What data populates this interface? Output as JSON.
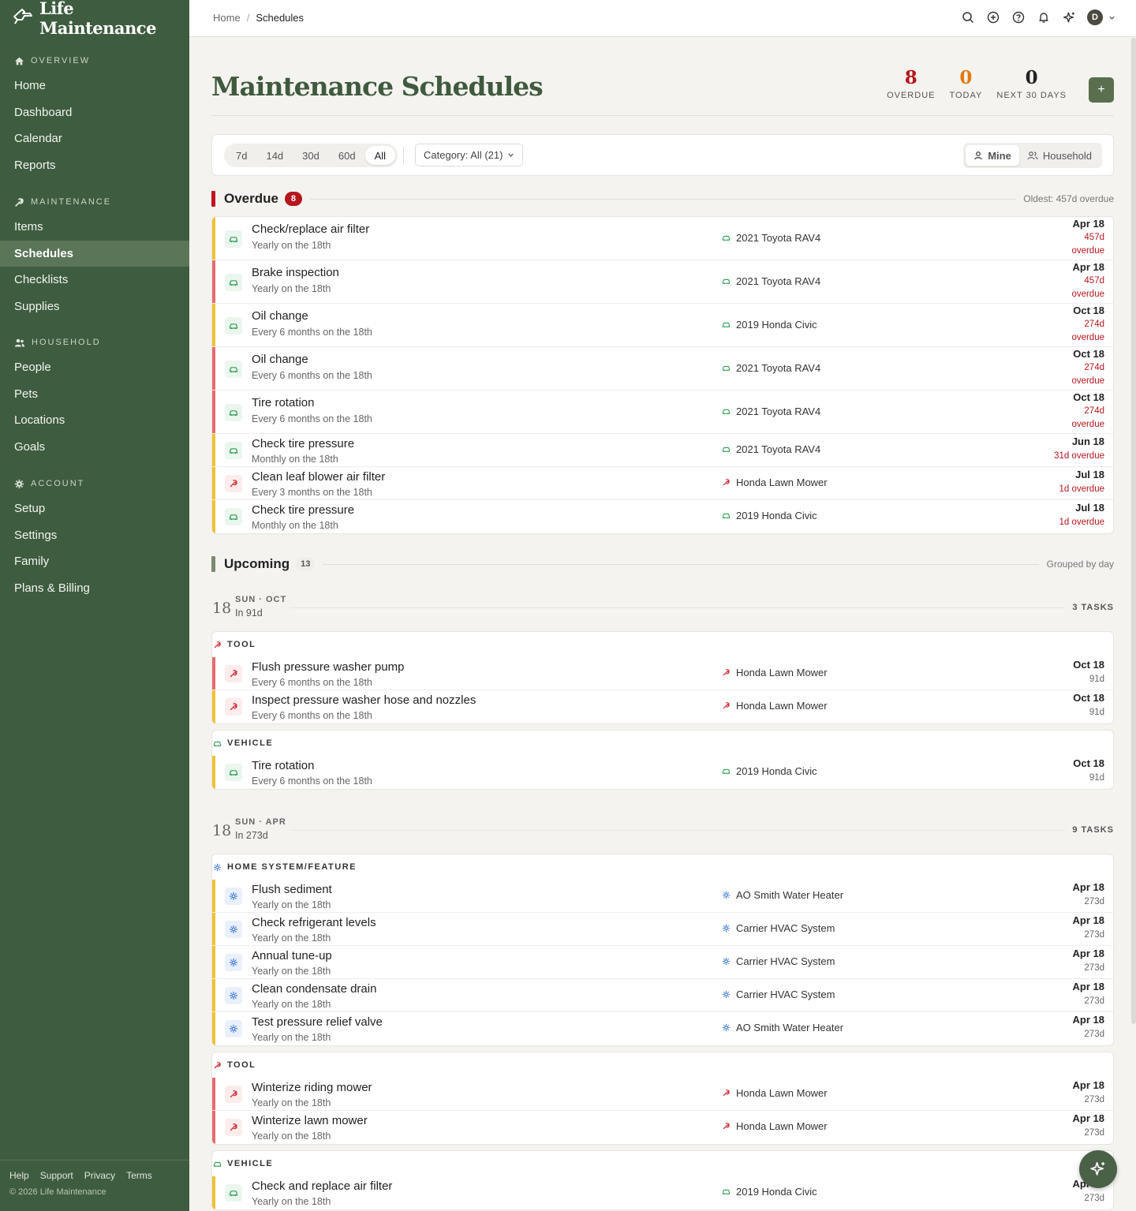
{
  "app": {
    "name": "Life Maintenance"
  },
  "sidebar": {
    "sections": [
      {
        "label": "OVERVIEW",
        "icon": "home-icon",
        "items": [
          "Home",
          "Dashboard",
          "Calendar",
          "Reports"
        ]
      },
      {
        "label": "MAINTENANCE",
        "icon": "wrench-icon",
        "items": [
          "Items",
          "Schedules",
          "Checklists",
          "Supplies"
        ]
      },
      {
        "label": "HOUSEHOLD",
        "icon": "people-icon",
        "items": [
          "People",
          "Pets",
          "Locations",
          "Goals"
        ]
      },
      {
        "label": "ACCOUNT",
        "icon": "gear-icon",
        "items": [
          "Setup",
          "Settings",
          "Family",
          "Plans & Billing"
        ]
      }
    ],
    "active": "Schedules",
    "footer_links": [
      "Help",
      "Support",
      "Privacy",
      "Terms"
    ],
    "copyright": "© 2026 Life Maintenance"
  },
  "breadcrumb": {
    "home": "Home",
    "sep": "/",
    "current": "Schedules"
  },
  "topbar": {
    "avatar_initial": "D",
    "icons": [
      "search-icon",
      "add-circle-icon",
      "help-icon",
      "bell-icon",
      "sparkle-icon"
    ]
  },
  "page": {
    "title": "Maintenance Schedules"
  },
  "stats": {
    "overdue": {
      "value": "8",
      "label": "OVERDUE",
      "color": "#b5161d"
    },
    "today": {
      "value": "0",
      "label": "TODAY",
      "color": "#e07b12"
    },
    "next30": {
      "value": "0",
      "label": "NEXT 30 DAYS",
      "color": "#222222"
    },
    "add_label": "+"
  },
  "filters": {
    "ranges": [
      "7d",
      "14d",
      "30d",
      "60d",
      "All"
    ],
    "active_range": "All",
    "category": "Category: All (21)",
    "scope": {
      "mine": "Mine",
      "household": "Household",
      "active": "Mine"
    }
  },
  "colors": {
    "vehicle": "#2f9d55",
    "tool": "#cf2e37",
    "home": "#2d6cd6",
    "bar_yellow": "#f0c232",
    "bar_red": "#e86a6f",
    "accent": "#3f5a3e"
  },
  "overdue": {
    "title": "Overdue",
    "count": "8",
    "oldest": "Oldest: 457d overdue",
    "rows": [
      {
        "title": "Check/replace air filter",
        "sub": "Yearly on the 18th",
        "item": "2021 Toyota RAV4",
        "cat": "vehicle",
        "bar": "yellow",
        "date": "Apr 18",
        "rel1": "457d",
        "rel2": "overdue"
      },
      {
        "title": "Brake inspection",
        "sub": "Yearly on the 18th",
        "item": "2021 Toyota RAV4",
        "cat": "vehicle",
        "bar": "red",
        "date": "Apr 18",
        "rel1": "457d",
        "rel2": "overdue"
      },
      {
        "title": "Oil change",
        "sub": "Every 6 months on the 18th",
        "item": "2019 Honda Civic",
        "cat": "vehicle",
        "bar": "yellow",
        "date": "Oct 18",
        "rel1": "274d",
        "rel2": "overdue"
      },
      {
        "title": "Oil change",
        "sub": "Every 6 months on the 18th",
        "item": "2021 Toyota RAV4",
        "cat": "vehicle",
        "bar": "red",
        "date": "Oct 18",
        "rel1": "274d",
        "rel2": "overdue"
      },
      {
        "title": "Tire rotation",
        "sub": "Every 6 months on the 18th",
        "item": "2021 Toyota RAV4",
        "cat": "vehicle",
        "bar": "red",
        "date": "Oct 18",
        "rel1": "274d",
        "rel2": "overdue"
      },
      {
        "title": "Check tire pressure",
        "sub": "Monthly on the 18th",
        "item": "2021 Toyota RAV4",
        "cat": "vehicle",
        "bar": "yellow",
        "date": "Jun 18",
        "rel1": "31d overdue"
      },
      {
        "title": "Clean leaf blower air filter",
        "sub": "Every 3 months on the 18th",
        "item": "Honda Lawn Mower",
        "cat": "tool",
        "bar": "yellow",
        "date": "Jul 18",
        "rel1": "1d overdue"
      },
      {
        "title": "Check tire pressure",
        "sub": "Monthly on the 18th",
        "item": "2019 Honda Civic",
        "cat": "vehicle",
        "bar": "yellow",
        "date": "Jul 18",
        "rel1": "1d overdue"
      }
    ]
  },
  "upcoming": {
    "title": "Upcoming",
    "count": "13",
    "note": "Grouped by day",
    "days": [
      {
        "num": "18",
        "label": "SUN · OCT",
        "sub": "In 91d",
        "count": "3 TASKS",
        "groups": [
          {
            "name": "TOOL",
            "cat": "tool",
            "rows": [
              {
                "title": "Flush pressure washer pump",
                "sub": "Every 6 months on the 18th",
                "item": "Honda Lawn Mower",
                "cat": "tool",
                "bar": "red",
                "date": "Oct 18",
                "rel1": "91d"
              },
              {
                "title": "Inspect pressure washer hose and nozzles",
                "sub": "Every 6 months on the 18th",
                "item": "Honda Lawn Mower",
                "cat": "tool",
                "bar": "yellow",
                "date": "Oct 18",
                "rel1": "91d"
              }
            ]
          },
          {
            "name": "VEHICLE",
            "cat": "vehicle",
            "rows": [
              {
                "title": "Tire rotation",
                "sub": "Every 6 months on the 18th",
                "item": "2019 Honda Civic",
                "cat": "vehicle",
                "bar": "yellow",
                "date": "Oct 18",
                "rel1": "91d"
              }
            ]
          }
        ]
      },
      {
        "num": "18",
        "label": "SUN · APR",
        "sub": "In 273d",
        "count": "9 TASKS",
        "groups": [
          {
            "name": "HOME SYSTEM/FEATURE",
            "cat": "home",
            "rows": [
              {
                "title": "Flush sediment",
                "sub": "Yearly on the 18th",
                "item": "AO Smith Water Heater",
                "cat": "home",
                "bar": "yellow",
                "date": "Apr 18",
                "rel1": "273d"
              },
              {
                "title": "Check refrigerant levels",
                "sub": "Yearly on the 18th",
                "item": "Carrier HVAC System",
                "cat": "home",
                "bar": "yellow",
                "date": "Apr 18",
                "rel1": "273d"
              },
              {
                "title": "Annual tune-up",
                "sub": "Yearly on the 18th",
                "item": "Carrier HVAC System",
                "cat": "home",
                "bar": "yellow",
                "date": "Apr 18",
                "rel1": "273d"
              },
              {
                "title": "Clean condensate drain",
                "sub": "Yearly on the 18th",
                "item": "Carrier HVAC System",
                "cat": "home",
                "bar": "yellow",
                "date": "Apr 18",
                "rel1": "273d"
              },
              {
                "title": "Test pressure relief valve",
                "sub": "Yearly on the 18th",
                "item": "AO Smith Water Heater",
                "cat": "home",
                "bar": "yellow",
                "date": "Apr 18",
                "rel1": "273d"
              }
            ]
          },
          {
            "name": "TOOL",
            "cat": "tool",
            "rows": [
              {
                "title": "Winterize riding mower",
                "sub": "Yearly on the 18th",
                "item": "Honda Lawn Mower",
                "cat": "tool",
                "bar": "red",
                "date": "Apr 18",
                "rel1": "273d"
              },
              {
                "title": "Winterize lawn mower",
                "sub": "Yearly on the 18th",
                "item": "Honda Lawn Mower",
                "cat": "tool",
                "bar": "red",
                "date": "Apr 18",
                "rel1": "273d"
              }
            ]
          },
          {
            "name": "VEHICLE",
            "cat": "vehicle",
            "rows": [
              {
                "title": "Check and replace air filter",
                "sub": "Yearly on the 18th",
                "item": "2019 Honda Civic",
                "cat": "vehicle",
                "bar": "yellow",
                "date": "Apr 18",
                "rel1": "273d"
              }
            ]
          }
        ]
      }
    ]
  }
}
